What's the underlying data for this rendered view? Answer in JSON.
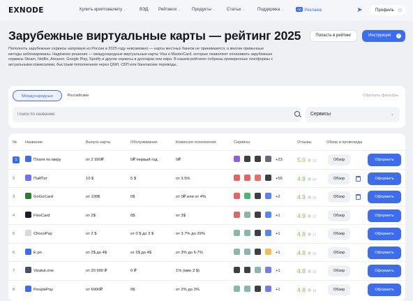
{
  "header": {
    "logo": "EXNODE",
    "nav": [
      "Купить криптовалюту",
      "ВЭД",
      "Рейтинги",
      "Продукты",
      "Статьи",
      "Поддержка"
    ],
    "ads_badge": "AD",
    "ads_label": "Реклама",
    "profile_label": "Профиль"
  },
  "page": {
    "title": "Зарубежные виртуальные карты — рейтинг 2025",
    "rate_button": "Попасть в рейтинг",
    "instruction_button": "Инструкция",
    "instruction_icon": "i",
    "description": "Пополнять зарубежные сервисы напрямую из России в 2025 году невозможно — карты местных банков не принимаются, а многие привычные методы заблокированы. Надёжное решение — международные виртуальные карты Visa и MasterCard, которые позволяют оплачивать зарубежные сервисы Steam, Netflix, Amazon, Google Play, Spotify и другие сервисы в долларах или евро. В нашем рейтинге собраны проверенные платформы с актуальными комиссиями, быстрым пополнением через QIWI, СБП или банковские переводы."
  },
  "filters": {
    "tab_international": "Международные",
    "tab_russian": "Российские",
    "reset": "Сбросить фильтры",
    "search_placeholder": "Поиск по названию",
    "services_select": "Сервисы"
  },
  "table": {
    "headers": {
      "num": "№",
      "name": "Название",
      "issue": "Выпуск карты",
      "service": "Обслуживание",
      "fee": "Комиссия пополнения",
      "services": "Сервисы",
      "reviews": "Отзывы",
      "overview": "Обзор и промокоды"
    },
    "overview_label": "Обзор",
    "apply_label": "Оформить",
    "rows": [
      {
        "num": "1",
        "name": "Плати по миру",
        "issue": "от 2 990₽",
        "service": "0₽ первый год",
        "fee": "0₽",
        "more": "+23",
        "rating": "5.0",
        "reviews": "10",
        "logo_color": "#3c6df0",
        "svc_colors": [
          "#7b3fe4",
          "#1b1d23",
          "#1b1d23",
          "#4b5060"
        ]
      },
      {
        "num": "2",
        "name": "ПэйПэт",
        "issue": "10 $",
        "service": "5 $",
        "fee": "от 3.5%",
        "more": "+55",
        "rating": "4.9",
        "reviews": "54",
        "logo_color": "#6f73f3",
        "svc_colors": [
          "#e04848",
          "#e04848",
          "#e8534d",
          "#1b1d23"
        ]
      },
      {
        "num": "3",
        "name": "GoGoCard",
        "issue": "от 109$",
        "service": "0$",
        "fee": "от 0₽ или от 4%",
        "more": "+2",
        "rating": "4.9",
        "reviews": "16",
        "logo_color": "#2f7d32",
        "svc_colors": [
          "#e04848",
          "#34a853",
          "#1b1d23",
          "#3c6df0"
        ]
      },
      {
        "num": "4",
        "name": "FlexCard",
        "issue": "от 2$",
        "service": "0$",
        "fee": "от 3$",
        "more": "+1",
        "rating": "4.9",
        "reviews": "17",
        "logo_color": "#1b1d23",
        "svc_colors": [
          "#e04848",
          "#74aa9c",
          "#1b1d23",
          "#3c6df0"
        ]
      },
      {
        "num": "5",
        "name": "ChocoPay",
        "issue": "от 2 $",
        "service": "от 0 $ до 3 $",
        "fee": "от 3.7% до 29%",
        "more": "+1",
        "rating": "4.8",
        "reviews": "17",
        "logo_color": "#d9d9d9",
        "svc_colors": [
          "#74aa9c",
          "#74aa9c",
          "#1b1d23",
          "#3c6df0"
        ]
      },
      {
        "num": "6",
        "name": "E.pn",
        "issue": "от 2$ до 4$",
        "service": "от 2$ до 4$",
        "fee": "от 3% до 6.7%",
        "more": "+1",
        "rating": "4.8",
        "reviews": "16",
        "logo_color": "#3c6df0",
        "svc_colors": [
          "#74aa9c",
          "#74aa9c",
          "#1b1d23",
          "#f2b233"
        ]
      },
      {
        "num": "7",
        "name": "Visatut.one",
        "issue": "от 20 990 ₽",
        "service": "0 ₽",
        "fee": "1% (мин 3 $)",
        "more": "+1",
        "rating": "4.8",
        "reviews": "15",
        "logo_color": "#4b5060",
        "svc_colors": [
          "#1b1d23",
          "#1b1d23",
          "#74aa9c",
          "#5865f2"
        ]
      },
      {
        "num": "8",
        "name": "PeoplePay",
        "issue": "от 6900₽",
        "service": "0$",
        "fee": "от 2% до 3%",
        "more": "+1",
        "rating": "4.8",
        "reviews": "15",
        "logo_color": "#3c6df0",
        "svc_colors": [
          "#74aa9c",
          "#74aa9c",
          "#1b1d23",
          "#5865f2"
        ]
      }
    ]
  }
}
